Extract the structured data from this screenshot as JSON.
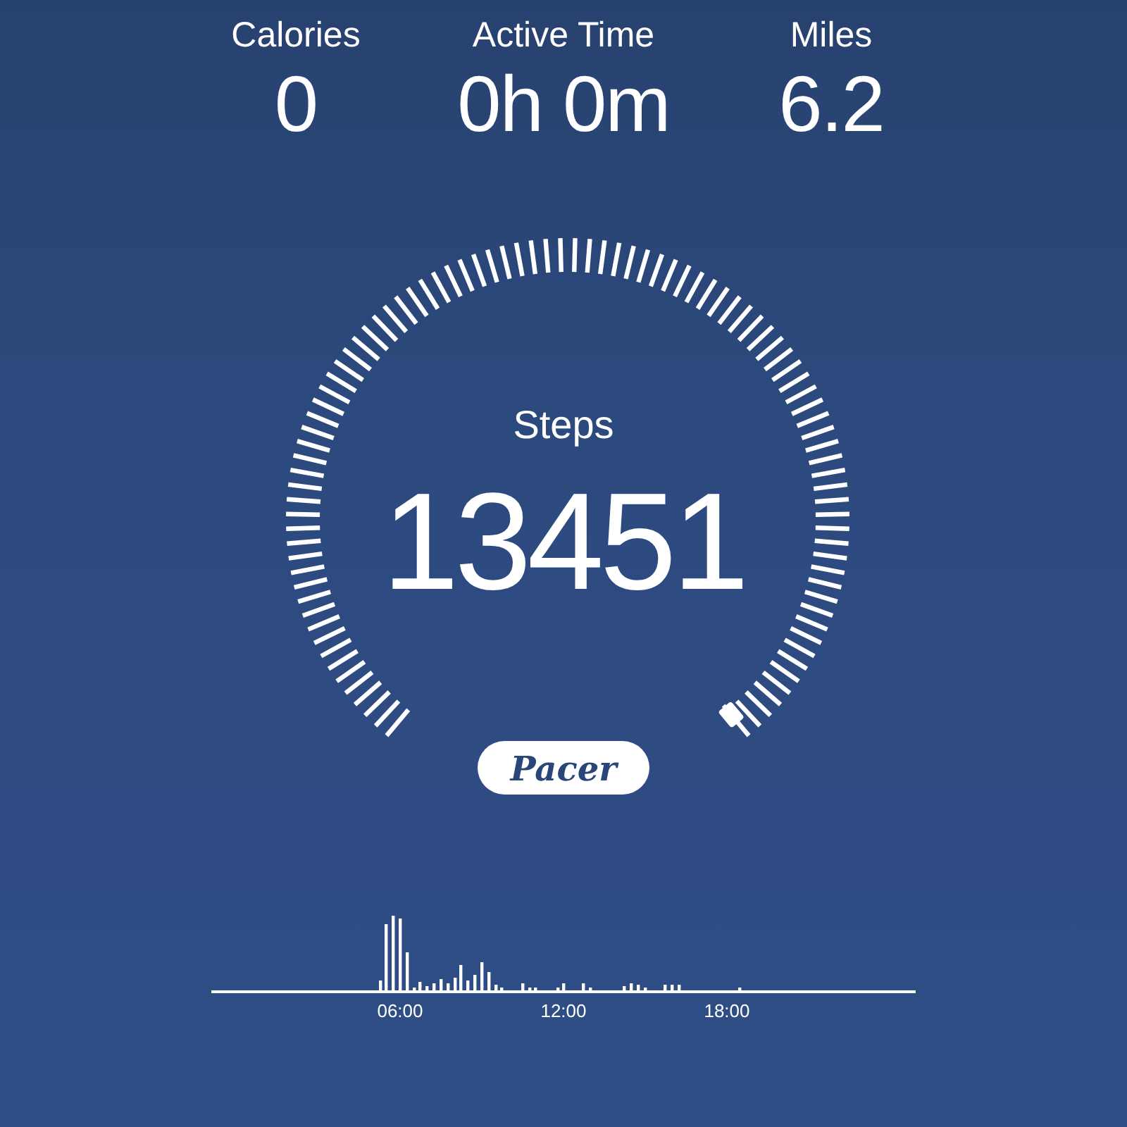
{
  "stats": [
    {
      "label": "Calories",
      "value": "0"
    },
    {
      "label": "Active Time",
      "value": "0h 0m"
    },
    {
      "label": "Miles",
      "value": "6.2"
    }
  ],
  "steps": {
    "label": "Steps",
    "value": "13451"
  },
  "logo": {
    "text": "Pacer"
  },
  "activity_chart": {
    "x_labels": [
      "06:00",
      "12:00",
      "18:00"
    ]
  }
}
